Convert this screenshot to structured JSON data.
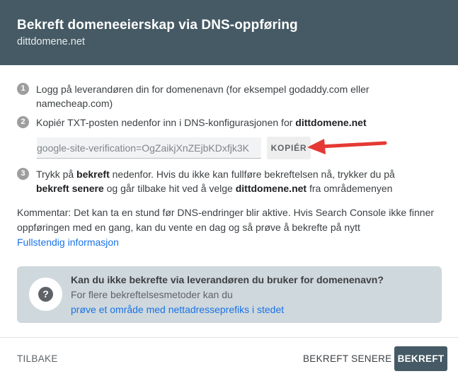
{
  "dialog": {
    "title": "Bekreft domeneeierskap via DNS-oppføring",
    "domain": "dittdomene.net"
  },
  "steps": [
    {
      "number": "1",
      "text": "Logg på leverandøren din for domenenavn (for eksempel godaddy.com eller",
      "text_line2": "namecheap.com)"
    },
    {
      "number": "2",
      "text": "Kopiér TXT-posten nedenfor inn i DNS-konfigurasjonen for ",
      "domain": "dittdomene.net"
    },
    {
      "number": "3",
      "text_a": "Trykk på ",
      "bold_a": "bekreft",
      "text_b": " nedenfor. Hvis du ikke kan fullføre bekreftelsen nå, trykker du på",
      "bold_b": "bekreft senere",
      "text_c": " og går tilbake hit ved å velge ",
      "bold_c": "dittdomene.net",
      "text_d": " fra områdemenyen"
    }
  ],
  "txt_record": {
    "value": "google-site-verification=OgZaikjXnZEjbKDxfjk3K",
    "copy_label": "KOPIÉR"
  },
  "comment": {
    "line1": "Kommentar: Det kan ta en stund før DNS-endringer blir aktive. Hvis Search Console ikke finner",
    "line2": "oppføringen med en gang, kan du vente en dag og så prøve å bekrefte på nytt",
    "link": "Fullstendig informasjon"
  },
  "info_box": {
    "icon": "help-icon",
    "title": "Kan du ikke bekrefte via leverandøren du bruker for domenenavn?",
    "line": "For flere bekreftelsesmetoder kan du",
    "link": "prøve et område med nettadresseprefiks i stedet"
  },
  "footer": {
    "back_label": "TILBAKE",
    "later_label": "BEKREFT SENERE",
    "confirm_label": "BEKREFT"
  },
  "colors": {
    "header_bg": "#455a64",
    "link": "#1a73e8",
    "info_bg": "#cfd8dc",
    "arrow": "#e53935"
  }
}
